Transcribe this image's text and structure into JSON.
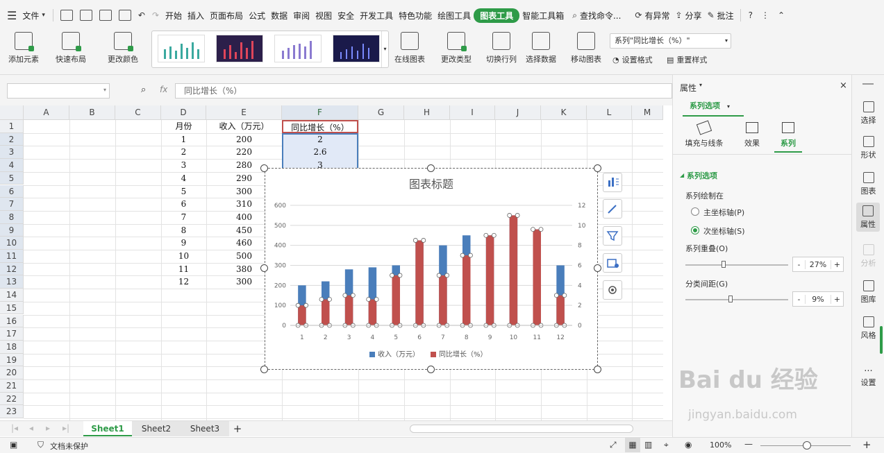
{
  "menubar": {
    "file": "文件",
    "tabs": [
      "开始",
      "插入",
      "页面布局",
      "公式",
      "数据",
      "审阅",
      "视图",
      "安全",
      "开发工具",
      "特色功能",
      "绘图工具",
      "图表工具",
      "智能工具箱"
    ],
    "active_tab": "图表工具",
    "search": "查找命令...",
    "user": "有异常",
    "share": "分享",
    "comment": "批注"
  },
  "ribbon": {
    "add_element": "添加元素",
    "quick_layout": "快速布局",
    "change_color": "更改颜色",
    "online_chart": "在线图表",
    "change_type": "更改类型",
    "switch_rowcol": "切换行列",
    "select_data": "选择数据",
    "move_chart": "移动图表",
    "series_select": "系列\"同比增长（%）\"",
    "format": "设置格式",
    "reset_style": "重置样式"
  },
  "formula": {
    "fx": "fx",
    "content": "同比增长（%）"
  },
  "columns": [
    "A",
    "B",
    "C",
    "D",
    "E",
    "F",
    "G",
    "H",
    "I",
    "J",
    "K",
    "L",
    "M"
  ],
  "rows": [
    "1",
    "2",
    "3",
    "4",
    "5",
    "6",
    "7",
    "8",
    "9",
    "10",
    "11",
    "12",
    "13",
    "14",
    "15",
    "16",
    "17",
    "18",
    "19",
    "20",
    "21",
    "22",
    "23"
  ],
  "sheet": {
    "h_month": "月份",
    "h_income": "收入（万元）",
    "h_growth": "同比增长（%）",
    "months": [
      "1",
      "2",
      "3",
      "4",
      "5",
      "6",
      "7",
      "8",
      "9",
      "10",
      "11",
      "12"
    ],
    "income": [
      "200",
      "220",
      "280",
      "290",
      "300",
      "310",
      "400",
      "450",
      "460",
      "500",
      "380",
      "300"
    ],
    "growth": [
      "2",
      "2.6",
      "3"
    ]
  },
  "chart_data": {
    "type": "bar",
    "title": "图表标题",
    "categories": [
      "1",
      "2",
      "3",
      "4",
      "5",
      "6",
      "7",
      "8",
      "9",
      "10",
      "11",
      "12"
    ],
    "series": [
      {
        "name": "收入（万元）",
        "axis": "primary",
        "color": "#4a7ebb",
        "values": [
          200,
          220,
          280,
          290,
          300,
          420,
          400,
          450,
          450,
          550,
          480,
          300
        ]
      },
      {
        "name": "同比增长（%）",
        "axis": "secondary",
        "color": "#c0504d",
        "values": [
          2,
          2.6,
          3,
          2.6,
          5,
          8.5,
          5,
          7,
          9,
          11,
          9.6,
          3
        ]
      }
    ],
    "ylim": [
      0,
      600
    ],
    "y2lim": [
      0,
      12
    ],
    "yticks": [
      "0",
      "100",
      "200",
      "300",
      "400",
      "500",
      "600"
    ],
    "y2ticks": [
      "0",
      "2",
      "4",
      "6",
      "8",
      "10",
      "12"
    ],
    "grid": true,
    "legend": "bottom"
  },
  "tabs": {
    "sheets": [
      "Sheet1",
      "Sheet2",
      "Sheet3"
    ],
    "add": "+"
  },
  "status": {
    "protect": "文档未保护",
    "zoom": "100%"
  },
  "panel": {
    "title": "属性",
    "option_tab": "系列选项",
    "sub_tabs": [
      "填充与线条",
      "效果",
      "系列"
    ],
    "section": "系列选项",
    "plot_on": "系列绘制在",
    "primary": "主坐标轴(P)",
    "secondary": "次坐标轴(S)",
    "overlap": "系列重叠(O)",
    "overlap_val": "27%",
    "gap": "分类间距(G)",
    "gap_val": "9%",
    "minus": "-",
    "plus": "+"
  },
  "rail": [
    "选择",
    "形状",
    "图表",
    "属性",
    "分析",
    "图库",
    "风格",
    "设置"
  ],
  "watermark": {
    "brand": "Bai du 经验",
    "url": "jingyan.baidu.com"
  }
}
